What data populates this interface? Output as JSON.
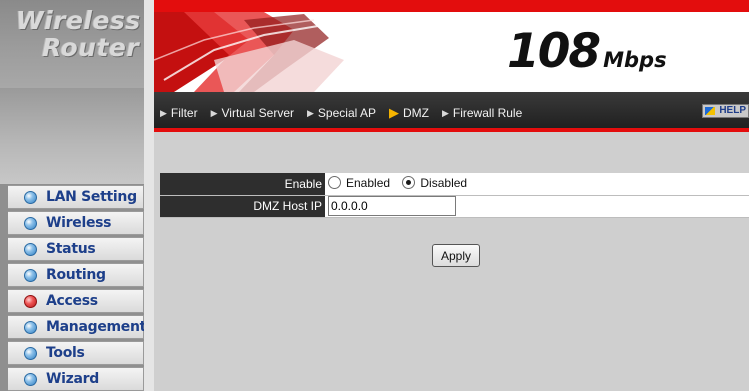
{
  "logo": {
    "line1": "Wireless",
    "line2": "Router"
  },
  "banner": {
    "speed_number": "108",
    "speed_unit": "Mbps"
  },
  "nav": {
    "items": [
      {
        "label": "Filter",
        "icon": "arrow-right-icon"
      },
      {
        "label": "Virtual Server",
        "icon": "arrow-right-icon"
      },
      {
        "label": "Special AP",
        "icon": "arrow-right-icon"
      },
      {
        "label": "DMZ",
        "icon": "arrow-right-icon",
        "current": true
      },
      {
        "label": "Firewall Rule",
        "icon": "arrow-right-icon"
      }
    ],
    "help_label": "HELP"
  },
  "sidebar": {
    "items": [
      {
        "label": "LAN Setting"
      },
      {
        "label": "Wireless"
      },
      {
        "label": "Status"
      },
      {
        "label": "Routing"
      },
      {
        "label": "Access",
        "active": true
      },
      {
        "label": "Management"
      },
      {
        "label": "Tools"
      },
      {
        "label": "Wizard"
      }
    ]
  },
  "form": {
    "enable_label": "Enable",
    "enabled_option": "Enabled",
    "disabled_option": "Disabled",
    "selected": "Disabled",
    "host_ip_label": "DMZ Host IP",
    "host_ip_value": "0.0.0.0",
    "apply_label": "Apply"
  },
  "colors": {
    "accent_red": "#e30d0d",
    "nav_bg": "#2a2a2a",
    "menu_text": "#1d3f8a",
    "content_bg": "#cfcfcf"
  }
}
